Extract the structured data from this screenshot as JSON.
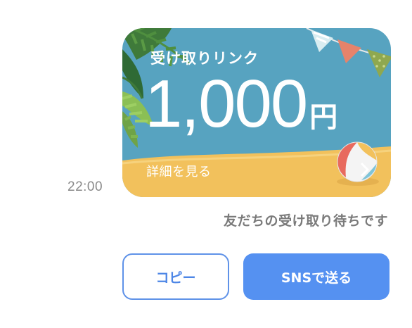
{
  "message": {
    "timestamp": "22:00"
  },
  "card": {
    "label": "受け取りリンク",
    "amount": "1,000",
    "currency": "円",
    "detail_link": "詳細を見る",
    "colors": {
      "sky": "#57a3c0",
      "sand": "#f2c15c",
      "text": "#ffffff"
    },
    "icons": [
      "palm-leaf-icon",
      "bunting-flags-icon",
      "beach-ball-icon",
      "chevron-right-icon"
    ]
  },
  "status_text": "友だちの受け取り待ちです",
  "buttons": {
    "copy_label": "コピー",
    "sns_label": "SNSで送る",
    "colors": {
      "primary": "#5591f1",
      "outline": "#5f92e8"
    }
  }
}
